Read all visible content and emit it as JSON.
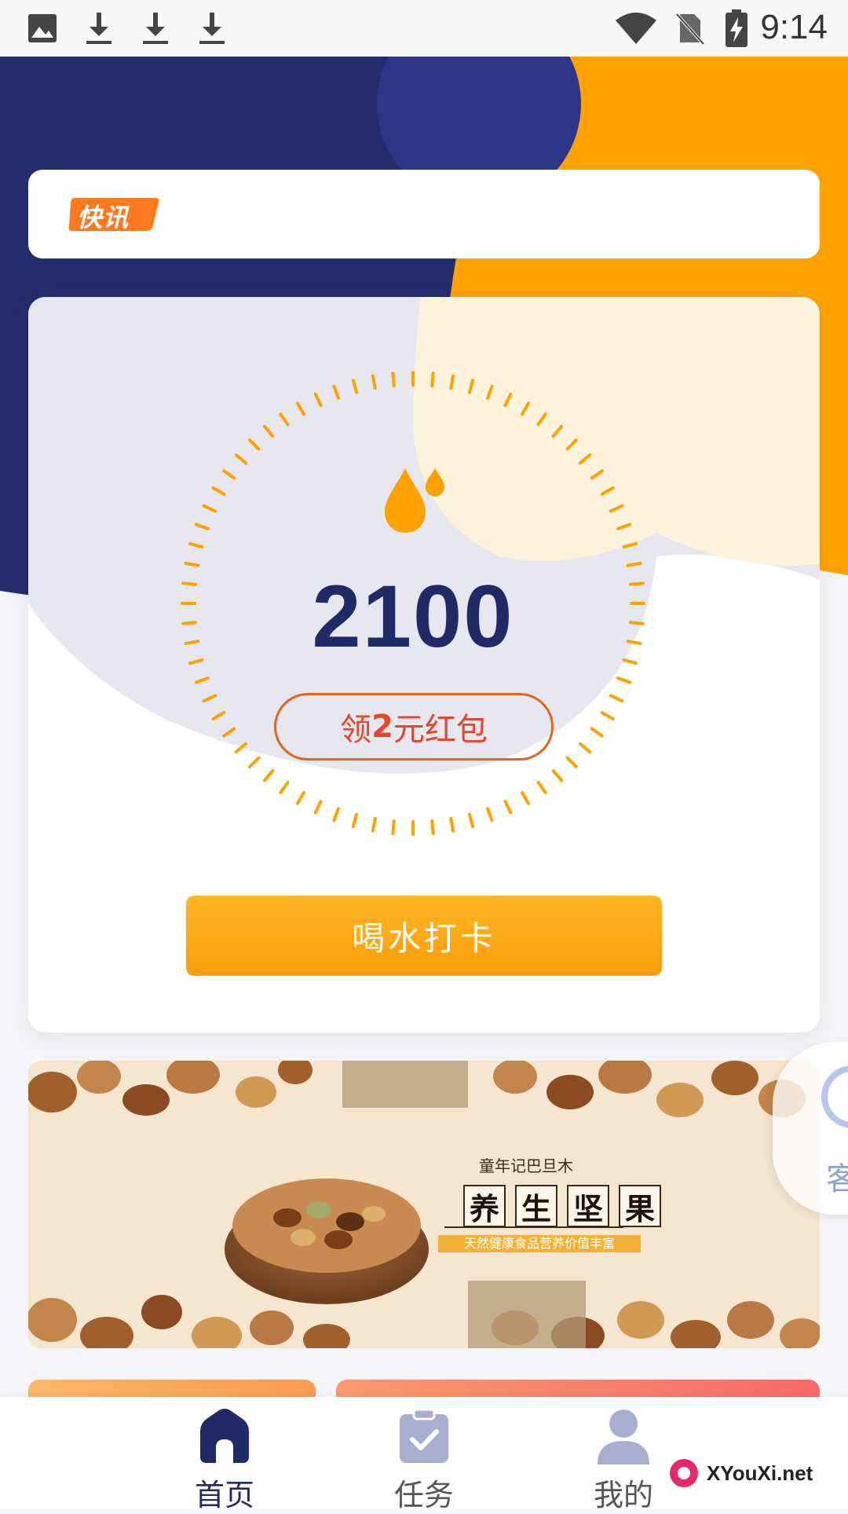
{
  "status_bar": {
    "time": "9:14"
  },
  "news": {
    "tag": "快讯"
  },
  "counter": {
    "value": "2100"
  },
  "redpacket": {
    "pre": "领",
    "amount": "2",
    "post": "元红包"
  },
  "checkin": {
    "label": "喝水打卡"
  },
  "banner": {
    "top_text": "童年记巴旦木",
    "title_chars": [
      "养",
      "生",
      "坚",
      "果"
    ],
    "subtitle": "天然健康食品营养价值丰富"
  },
  "service": {
    "label": "客"
  },
  "nav": [
    {
      "label": "首页",
      "active": true
    },
    {
      "label": "任务",
      "active": false
    },
    {
      "label": "我的",
      "active": false
    }
  ],
  "watermark": {
    "text": "XYouXi.net"
  },
  "colors": {
    "navy": "#1f2a66",
    "orange": "#ffa200",
    "cream": "#fdf3dd",
    "button_orange": "#fb9d0d",
    "red_text": "#e8442a"
  }
}
